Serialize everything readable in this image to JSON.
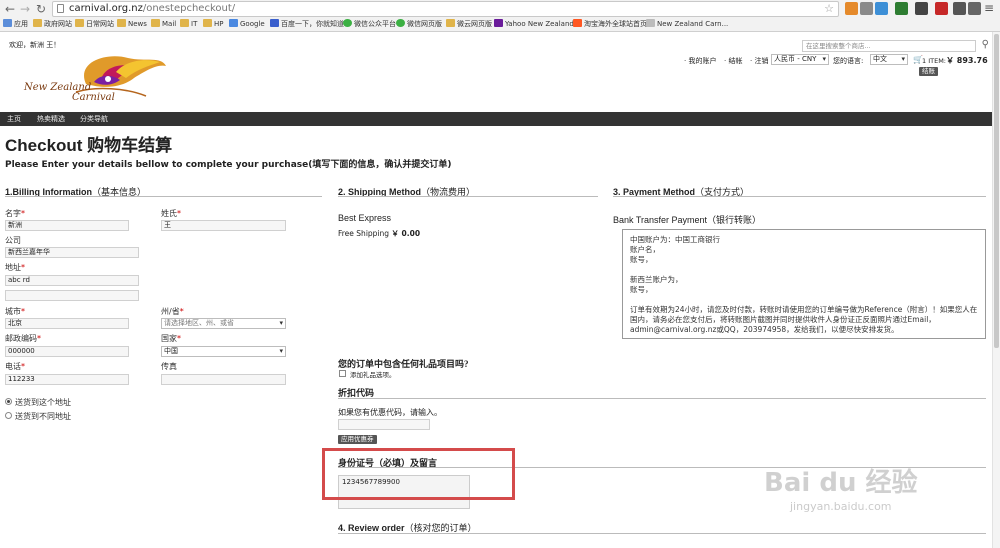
{
  "browser": {
    "url_domain": "carnival.org.nz",
    "url_path": "/onestepcheckout/",
    "bookmarks": [
      "应用",
      "政府网站",
      "日常网站",
      "News",
      "Mail",
      "IT",
      "HP",
      "Google",
      "百度一下，你就知道",
      "微信公众平台",
      "微信网页版",
      "微云网页版",
      "Yahoo New Zealand",
      "淘宝海外全球站首页",
      "New Zealand Carn..."
    ]
  },
  "header": {
    "welcome": "欢迎，新洲 王！",
    "search_placeholder": "在这里搜索整个商店...",
    "links": {
      "account": "我的账户",
      "checkout": "结帐",
      "logout": "注销"
    },
    "currency": "人民币 - CNY",
    "lang_label": "您的语言:",
    "lang": "中文",
    "cart_count": "1 ITEM:",
    "cart_total": "￥ 893.76",
    "cart_btn": "结账"
  },
  "logo": {
    "line1": "New Zealand",
    "line2": "Carnival"
  },
  "nav": {
    "home": "主页",
    "hot": "热卖精选",
    "category": "分类导航"
  },
  "page": {
    "title": "Checkout 购物车结算",
    "subtitle": "Please Enter your details bellow to complete your purchase(填写下面的信息，确认并提交订单)"
  },
  "billing": {
    "title": "1.Billing Information",
    "title_cn": "（基本信息）",
    "first_name_label": "名字",
    "first_name": "新洲",
    "last_name_label": "姓氏",
    "last_name": "王",
    "company_label": "公司",
    "company": "新西兰嘉年华",
    "address_label": "地址",
    "address1": "abc rd",
    "address2": "",
    "city_label": "城市",
    "city": "北京",
    "state_label": "州/省",
    "state": "请选择地区、州、或省",
    "zip_label": "邮政编码",
    "zip": "000000",
    "country_label": "国家",
    "country": "中国",
    "phone_label": "电话",
    "phone": "112233",
    "fax_label": "传真",
    "fax": "",
    "ship_same": "送货到这个地址",
    "ship_diff": "送货到不同地址"
  },
  "shipping": {
    "title": "2. Shipping Method",
    "title_cn": "（物流费用）",
    "carrier": "Best Express",
    "option": "Free Shipping",
    "price": "￥ 0.00"
  },
  "payment": {
    "title": "3. Payment Method",
    "title_cn": "（支付方式）",
    "method": "Bank Transfer Payment",
    "method_cn": "（银行转账）",
    "info": "中国账户为：中国工商银行\n账户名，\n账号，\n\n新西兰账户为，\n账号，\n\n订单有效期为24小时，请您及时付款，转账时请使用您的订单编号做为Reference（附言）！如果您人在国内，请务必在您支付后，将转账图片截图并同时提供收件人身份证正反面照片通过Email，admin@carnival.org.nz或QQ，203974958，发给我们，以便尽快安排发货。"
  },
  "gift": {
    "question": "您的订单中包含任何礼品项目吗?",
    "option": "添加礼品选项。"
  },
  "coupon": {
    "title": "折扣代码",
    "prompt": "如果您有优惠代码，请输入。",
    "button": "应用优惠券"
  },
  "idcard": {
    "title": "身份证号（必填）及留言",
    "value": "1234567789900"
  },
  "review": {
    "title": "4. Review order",
    "title_cn": "（核对您的订单）"
  },
  "watermark": {
    "brand": "Bai du 经验",
    "url": "jingyan.baidu.com"
  }
}
